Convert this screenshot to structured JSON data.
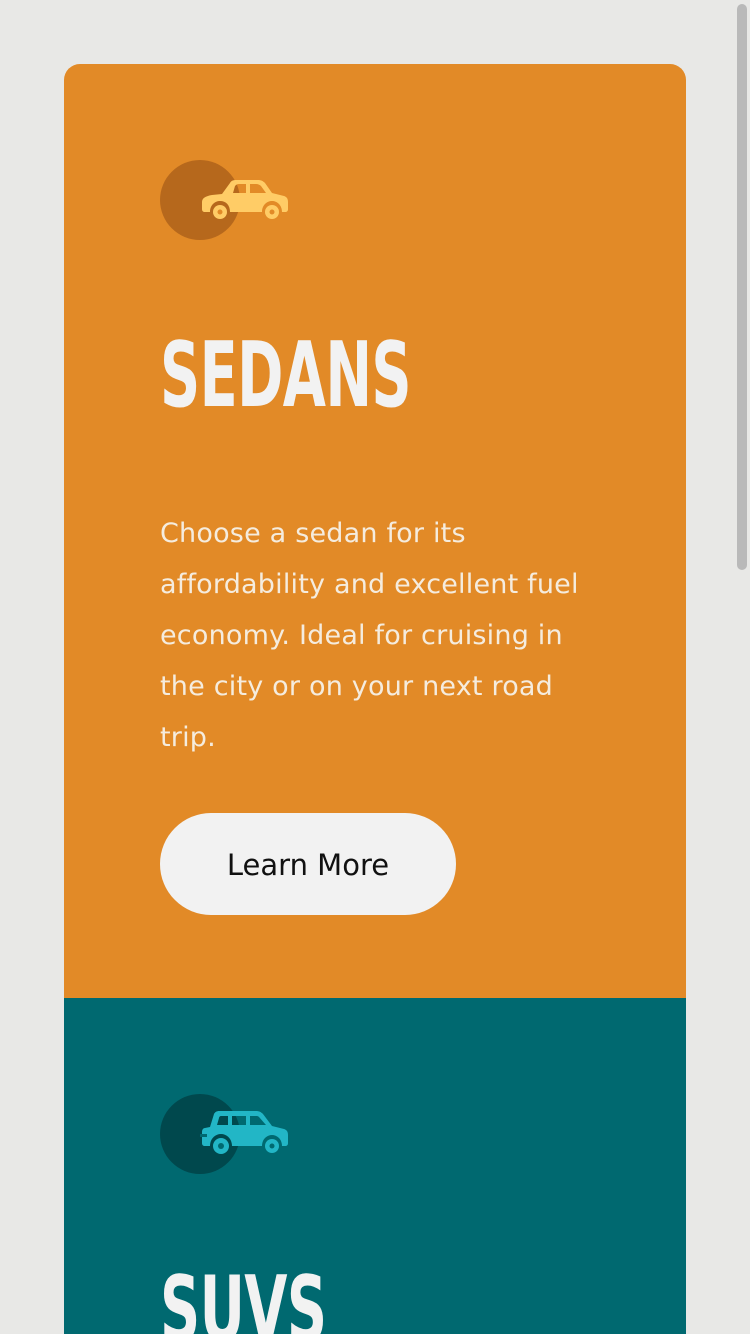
{
  "colors": {
    "page_background": "#e8e8e6",
    "sedans_card": "#e28a27",
    "suvs_card": "#006970",
    "sedans_icon_circle": "#b6681c",
    "suvs_icon_circle": "#00484d",
    "sedans_icon": "#ffcc66",
    "suvs_icon": "#22b6c6",
    "title_text": "#f2f2f2",
    "button_background": "#f2f2f2"
  },
  "cards": {
    "sedans": {
      "icon": "sedan-car-icon",
      "title": "Sedans",
      "description": "Choose a sedan for its affordability and excellent fuel economy. Ideal for cruising in the city or on your next road trip.",
      "button_label": "Learn More"
    },
    "suvs": {
      "icon": "suv-car-icon",
      "title": "SUVs"
    }
  }
}
